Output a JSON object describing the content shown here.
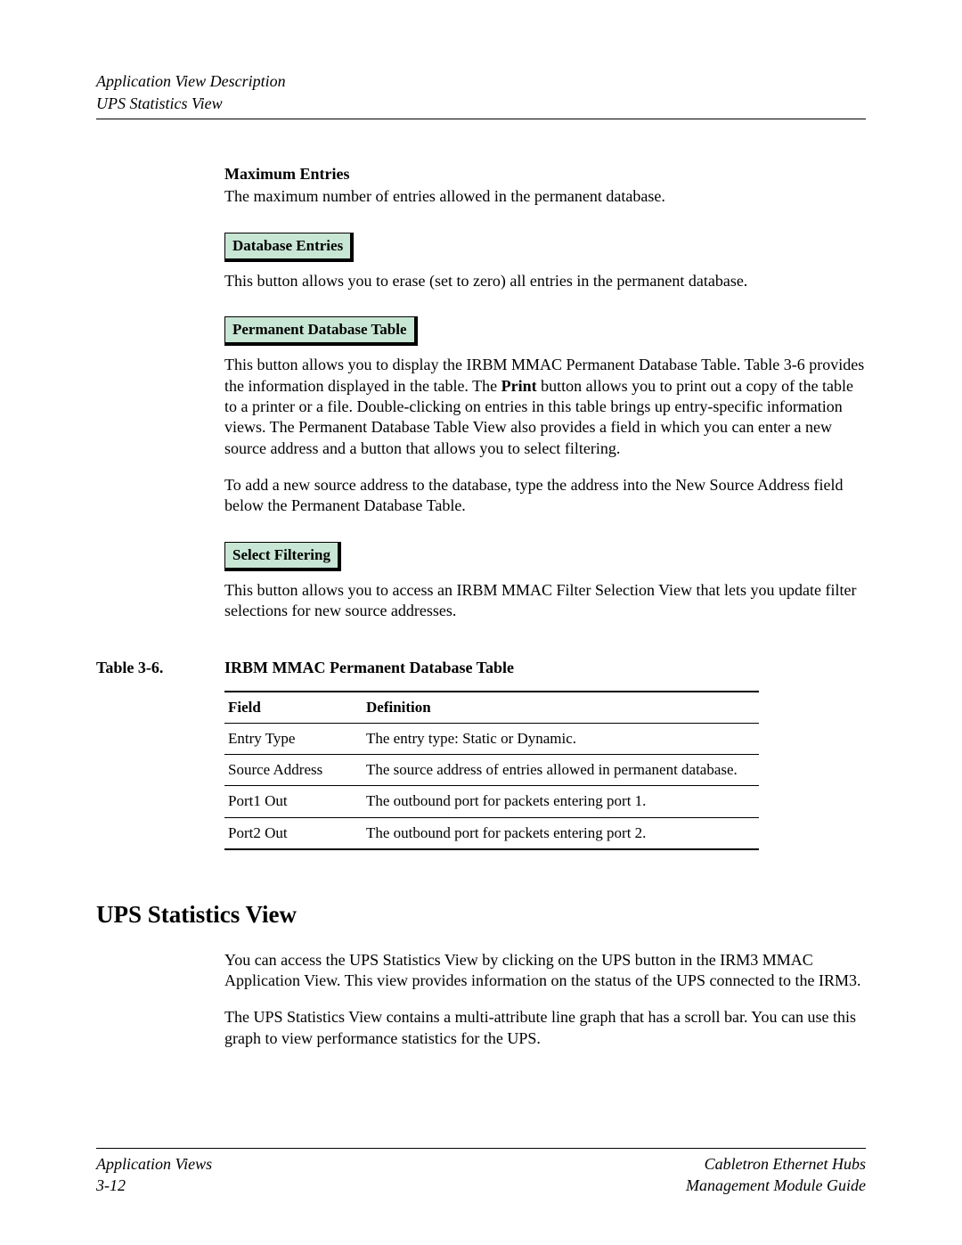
{
  "header": {
    "top": "Application View Description",
    "sub": "UPS Statistics View"
  },
  "sections": {
    "max_entries": {
      "heading": "Maximum Entries",
      "body": "The maximum number of entries allowed in the permanent database."
    },
    "db_entries": {
      "button": "Database Entries",
      "body": "This button allows you to erase (set to zero) all entries in the permanent database."
    },
    "perm_db_table": {
      "button": "Permanent Database Table",
      "body1_a": "This button allows you to display the IRBM MMAC Permanent Database Table. Table 3-6 provides the information displayed in the table. The ",
      "body1_bold": "Print",
      "body1_b": " button allows you to print out a copy of the table to a printer or a file. Double-clicking on entries in this table brings up entry-specific information views. The Permanent Database Table View also provides a field in which you can enter a new source address and a button that allows you to select filtering.",
      "body2": "To add a new source address to the database, type the address into the New Source Address field below the Permanent Database Table."
    },
    "select_filtering": {
      "button": "Select Filtering",
      "body": "This button allows you to access an IRBM MMAC Filter Selection View that lets you update filter selections for new source addresses."
    }
  },
  "table": {
    "caption_label": "Table 3-6.",
    "caption_title": "IRBM MMAC Permanent Database Table",
    "headers": {
      "field": "Field",
      "definition": "Definition"
    },
    "rows": [
      {
        "field": "Entry Type",
        "definition": "The entry type: Static or Dynamic."
      },
      {
        "field": "Source Address",
        "definition": "The source address of entries allowed in permanent database."
      },
      {
        "field": "Port1 Out",
        "definition": "The outbound port for packets entering port 1."
      },
      {
        "field": "Port2 Out",
        "definition": "The outbound port for packets entering port 2."
      }
    ]
  },
  "ups_section": {
    "heading": "UPS Statistics View",
    "body1": "You can access the UPS Statistics View by clicking on the UPS button in the IRM3 MMAC Application View. This view provides information on the status of the UPS connected to the IRM3.",
    "body2": "The UPS Statistics View contains a multi-attribute line graph that has a scroll bar. You can use this graph to view performance statistics for the UPS."
  },
  "footer": {
    "left1": "Application Views",
    "left2": "3-12",
    "right1": "Cabletron Ethernet Hubs",
    "right2": "Management Module Guide"
  }
}
